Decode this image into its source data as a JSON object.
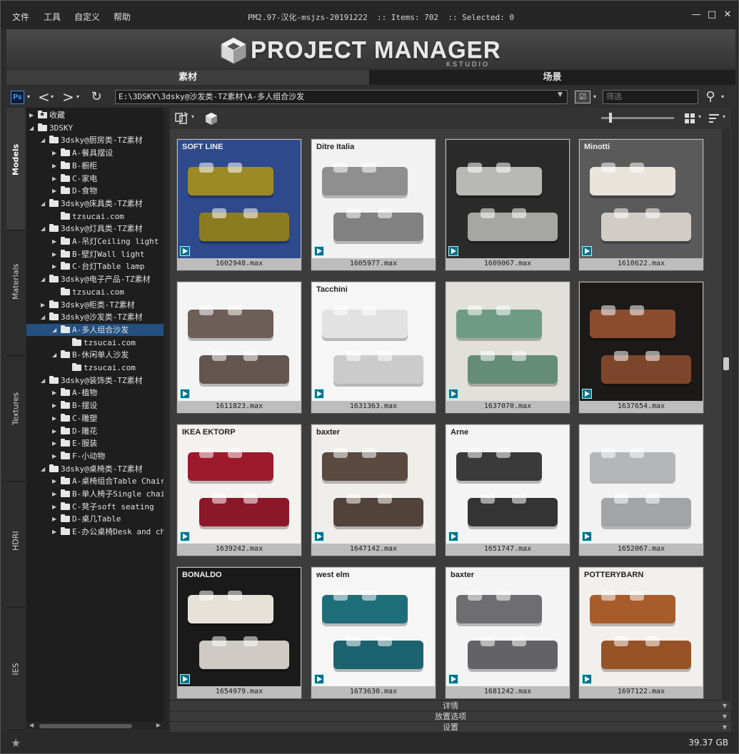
{
  "menu": {
    "file": "文件",
    "tools": "工具",
    "customize": "自定义",
    "help": "帮助"
  },
  "window": {
    "title": "PM2.97-汉化-msjzs-20191222  :: Items: 702  :: Selected: 0",
    "minimize_glyph": "—",
    "maximize_glyph": "□",
    "close_glyph": "✕"
  },
  "logo": {
    "main": "PROJECT MANAGER",
    "sub": "KSTUDIO"
  },
  "tabs": {
    "assets": "素材",
    "scenes": "场景"
  },
  "pathbar": {
    "ps_label": "Ps",
    "back_glyph": "<",
    "forward_glyph": ">",
    "refresh_glyph": "↻",
    "path": "E:\\3DSKY\\3dsky@沙发类-TZ素材\\A-多人组合沙发",
    "filter_placeholder": "筛选",
    "search_glyph": "⚲"
  },
  "side_tabs": [
    "Models",
    "Materials",
    "Textures",
    "HDRI",
    "IES"
  ],
  "tree": [
    {
      "label": "收藏",
      "level": 0,
      "expanded": false,
      "icon": "star-folder-icon"
    },
    {
      "label": "3DSKY",
      "level": 0,
      "expanded": true
    },
    {
      "label": "3dsky@厨房类-TZ素材",
      "level": 1,
      "expanded": true
    },
    {
      "label": "A-餐具摆设",
      "level": 2,
      "expanded": false
    },
    {
      "label": "B-橱柜",
      "level": 2,
      "expanded": false
    },
    {
      "label": "C-家电",
      "level": 2,
      "expanded": false
    },
    {
      "label": "D-食物",
      "level": 2,
      "expanded": false
    },
    {
      "label": "3dsky@床具类-TZ素材",
      "level": 1,
      "expanded": true
    },
    {
      "label": "tzsucai.com",
      "level": 2,
      "leaf": true
    },
    {
      "label": "3dsky@灯具类-TZ素材",
      "level": 1,
      "expanded": true
    },
    {
      "label": "A-吊灯Ceiling light",
      "level": 2,
      "expanded": false
    },
    {
      "label": "B-壁灯Wall light",
      "level": 2,
      "expanded": false
    },
    {
      "label": "C-台灯Table lamp",
      "level": 2,
      "expanded": false
    },
    {
      "label": "3dsky@电子产品-TZ素材",
      "level": 1,
      "expanded": true
    },
    {
      "label": "tzsucai.com",
      "level": 2,
      "leaf": true
    },
    {
      "label": "3dsky@柜类-TZ素材",
      "level": 1,
      "expanded": false
    },
    {
      "label": "3dsky@沙发类-TZ素材",
      "level": 1,
      "expanded": true
    },
    {
      "label": "A-多人组合沙发",
      "level": 2,
      "expanded": true,
      "selected": true
    },
    {
      "label": "tzsucai.com",
      "level": 3,
      "leaf": true
    },
    {
      "label": "B-休闲单人沙发",
      "level": 2,
      "expanded": true
    },
    {
      "label": "tzsucai.com",
      "level": 3,
      "leaf": true
    },
    {
      "label": "3dsky@装饰类-TZ素材",
      "level": 1,
      "expanded": true
    },
    {
      "label": "A-植物",
      "level": 2,
      "expanded": false
    },
    {
      "label": "B-摆设",
      "level": 2,
      "expanded": false
    },
    {
      "label": "C-雕塑",
      "level": 2,
      "expanded": false
    },
    {
      "label": "D-雕花",
      "level": 2,
      "expanded": false
    },
    {
      "label": "E-服装",
      "level": 2,
      "expanded": false
    },
    {
      "label": "F-小动物",
      "level": 2,
      "expanded": false
    },
    {
      "label": "3dsky@桌椅类-TZ素材",
      "level": 1,
      "expanded": true
    },
    {
      "label": "A-桌椅组合Table Chair",
      "level": 2,
      "expanded": false
    },
    {
      "label": "B-单人椅子Single chair",
      "level": 2,
      "expanded": false
    },
    {
      "label": "C-凳子soft seating",
      "level": 2,
      "expanded": false
    },
    {
      "label": "D-桌几Table",
      "level": 2,
      "expanded": false
    },
    {
      "label": "E-办公桌椅Desk and chair",
      "level": 2,
      "expanded": false
    }
  ],
  "items": [
    {
      "file": "1602948.max",
      "bg": "#2e4a8c",
      "sofa": "#9c8a25",
      "brand": "SOFT LINE"
    },
    {
      "file": "1605977.max",
      "bg": "#f2f2f2",
      "sofa": "#8f8f8f",
      "brand": "Ditre Italia"
    },
    {
      "file": "1609067.max",
      "bg": "#2a2a2a",
      "sofa": "#b8b8b4",
      "brand": ""
    },
    {
      "file": "1610622.max",
      "bg": "#5a5a5a",
      "sofa": "#e8e4dc",
      "brand": "Minotti"
    },
    {
      "file": "1611823.max",
      "bg": "#f4f4f4",
      "sofa": "#6e5e58",
      "brand": ""
    },
    {
      "file": "1631363.max",
      "bg": "#f6f6f6",
      "sofa": "#e2e2e2",
      "brand": "Tacchini"
    },
    {
      "file": "1637070.max",
      "bg": "#e2e0da",
      "sofa": "#6f9b86",
      "brand": ""
    },
    {
      "file": "1637654.max",
      "bg": "#1c1a18",
      "sofa": "#8b4d2e",
      "brand": ""
    },
    {
      "file": "1639242.max",
      "bg": "#f4f2ee",
      "sofa": "#9c1a2c",
      "brand": "IKEA EKTORP"
    },
    {
      "file": "1647142.max",
      "bg": "#f0eeea",
      "sofa": "#5a4a40",
      "brand": "baxter"
    },
    {
      "file": "1651747.max",
      "bg": "#f4f4f4",
      "sofa": "#3a3a3a",
      "brand": "Arne"
    },
    {
      "file": "1652067.max",
      "bg": "#f2f2f2",
      "sofa": "#b4b6b8",
      "brand": ""
    },
    {
      "file": "1654979.max",
      "bg": "#1a1a1a",
      "sofa": "#e6e2da",
      "brand": "BONALDO"
    },
    {
      "file": "1673630.max",
      "bg": "#f6f6f6",
      "sofa": "#1e6e7a",
      "brand": "west elm"
    },
    {
      "file": "1681242.max",
      "bg": "#f4f4f4",
      "sofa": "#6e6e70",
      "brand": "baxter"
    },
    {
      "file": "1697122.max",
      "bg": "#f2f0ec",
      "sofa": "#a85c2c",
      "brand": "POTTERYBARN"
    }
  ],
  "panels": {
    "details": "详情",
    "placement": "放置选项",
    "settings": "设置"
  },
  "status": {
    "disk_free": "39.37 GB",
    "star_glyph": "★"
  }
}
